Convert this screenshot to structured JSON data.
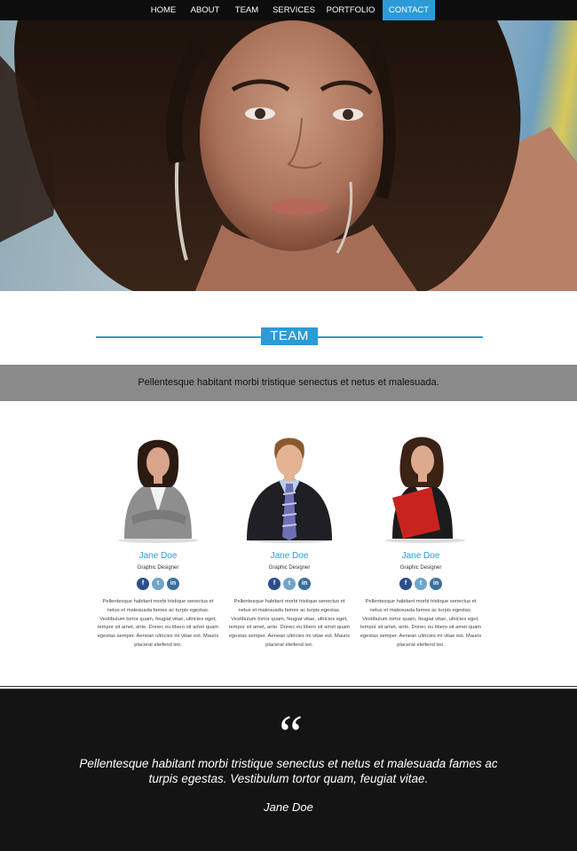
{
  "nav": {
    "items": [
      {
        "label": "HOME"
      },
      {
        "label": "ABOUT"
      },
      {
        "label": "TEAM"
      },
      {
        "label": "SERVICES"
      },
      {
        "label": "PORTFOLIO"
      },
      {
        "label": "CONTACT",
        "active": true
      }
    ]
  },
  "hero": {
    "image": "woman-portrait-banner"
  },
  "team": {
    "title": "TEAM",
    "tagline": "Pellentesque habitant morbi tristique senectus et netus et malesuada.",
    "members": [
      {
        "name": "Jane Doe",
        "role": "Graphic Designer",
        "photo": "businesswoman-grey-suit-photo",
        "bio": "Pellentesque habitant morbi tristique senectus et netus et malesuada fames ac turpis egestas. Vestibulum tortor quam, feugiat vitae, ultricies eget, tempor sit amet, ante. Donec eu libero sit amet quam egestas semper. Aenean ultricies mi vitae est. Mauris placerat eleifend leo."
      },
      {
        "name": "Jane Doe",
        "role": "Graphic Designer",
        "photo": "businessman-blue-tie-photo",
        "bio": "Pellentesque habitant morbi tristique senectus et netus et malesuada fames ac turpis egestas. Vestibulum tortor quam, feugiat vitae, ultricies eget, tempor sit amet, ante. Donec eu libero sit amet quam egestas semper. Aenean ultricies mi vitae est. Mauris placerat eleifend leo."
      },
      {
        "name": "Jane Doe",
        "role": "Graphic Designer",
        "photo": "businesswoman-red-folder-photo",
        "bio": "Pellentesque habitant morbi tristique senectus et netus et malesuada fames ac turpis egestas. Vestibulum tortor quam, feugiat vitae, ultricies eget, tempor sit amet, ante. Donec eu libero sit amet quam egestas semper. Aenean ultricies mi vitae est. Mauris placerat eleifend leo."
      }
    ],
    "social_icons": [
      "facebook-icon",
      "twitter-icon",
      "linkedin-icon"
    ]
  },
  "testimonial": {
    "mark": "“",
    "text": "Pellentesque habitant morbi tristique senectus et netus et malesuada fames ac turpis egestas. Vestibulum tortor quam, feugiat vitae.",
    "author": "Jane Doe"
  },
  "colors": {
    "accent": "#2d9ad6",
    "nav_bg": "#0d0d0d",
    "band_bg": "#8a8a8a",
    "footer_bg": "#141414"
  }
}
